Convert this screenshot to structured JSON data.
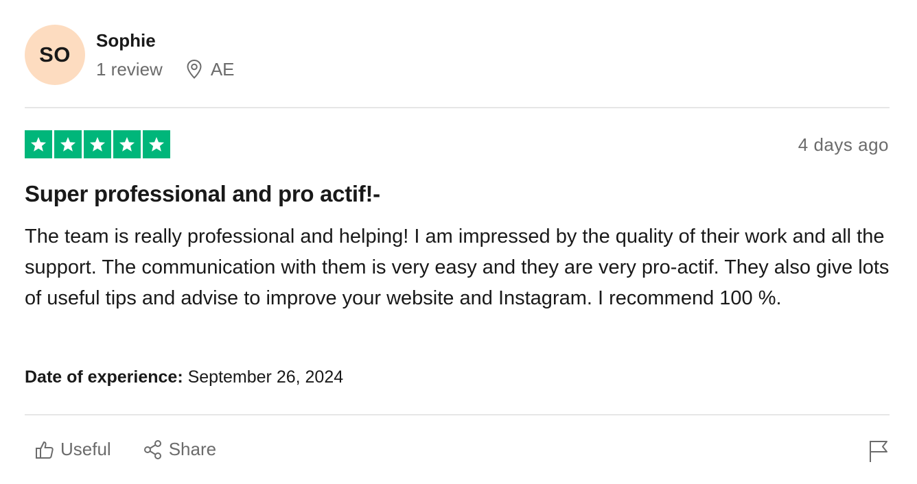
{
  "reviewer": {
    "initials": "SO",
    "name": "Sophie",
    "review_count": "1 review",
    "location": "AE",
    "location_icon": "map-pin-icon"
  },
  "review": {
    "rating": 5,
    "rating_max": 5,
    "star_color": "#00b67a",
    "posted": "4 days ago",
    "title": "Super professional and pro actif!-",
    "body": "The team is really professional and helping! I am impressed by the quality of their work and all the support. The communication with them is very easy and they are very pro-actif. They also give lots of useful tips and advise to improve your website and Instagram. I recommend 100 %.",
    "experience_label": "Date of experience:",
    "experience_date": "September 26, 2024"
  },
  "actions": {
    "useful_label": "Useful",
    "useful_icon": "thumbs-up-icon",
    "share_label": "Share",
    "share_icon": "share-icon",
    "report_icon": "flag-icon"
  }
}
